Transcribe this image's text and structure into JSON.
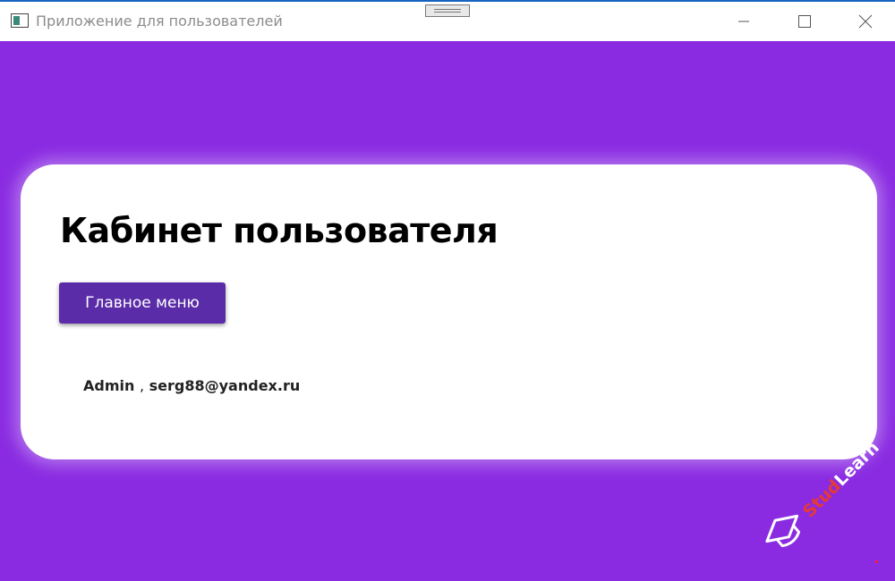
{
  "window": {
    "title": "Приложение для пользователей"
  },
  "page": {
    "title": "Кабинет пользователя",
    "main_menu_label": "Главное меню",
    "user": {
      "login": "Admin",
      "separator": ",",
      "email": "serg88@yandex.ru"
    }
  },
  "watermark": {
    "part1": "Stud",
    "part2": "Learn"
  },
  "colors": {
    "background": "#8a2be2",
    "button": "#5a2ca8",
    "card": "#ffffff",
    "watermark_red": "#e53935"
  }
}
